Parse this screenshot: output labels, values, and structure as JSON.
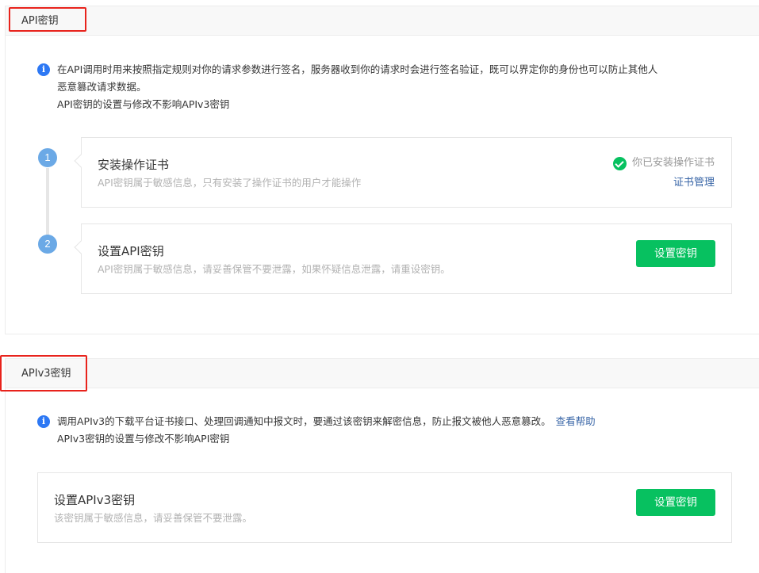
{
  "api_section": {
    "title": "API密钥",
    "notice_lines": [
      "在API调用时用来按照指定规则对你的请求参数进行签名，服务器收到你的请求时会进行签名验证，既可以界定你的身份也可以防止其他人",
      "恶意篡改请求数据。",
      "API密钥的设置与修改不影响APIv3密钥"
    ],
    "steps": [
      {
        "number": "1",
        "title": "安装操作证书",
        "description": "API密钥属于敏感信息，只有安装了操作证书的用户才能操作",
        "status_text": "你已安装操作证书",
        "link_label": "证书管理"
      },
      {
        "number": "2",
        "title": "设置API密钥",
        "description": "API密钥属于敏感信息，请妥善保管不要泄露，如果怀疑信息泄露，请重设密钥。",
        "button_label": "设置密钥"
      }
    ]
  },
  "apiv3_section": {
    "title": "APIv3密钥",
    "notice_line1": "调用APIv3的下载平台证书接口、处理回调通知中报文时，要通过该密钥来解密信息，防止报文被他人恶意篡改。",
    "help_link": "查看帮助",
    "notice_line2": "APIv3密钥的设置与修改不影响API密钥",
    "card": {
      "title": "设置APIv3密钥",
      "description": "该密钥属于敏感信息，请妥善保管不要泄露。",
      "button_label": "设置密钥"
    }
  },
  "colors": {
    "accent_green": "#07c160",
    "link_blue": "#3764a6",
    "info_blue": "#2d78f4",
    "step_blue": "#6ba9e6",
    "highlight_red": "#e8231c"
  },
  "icons": [
    "info-icon",
    "check-circle-icon"
  ]
}
